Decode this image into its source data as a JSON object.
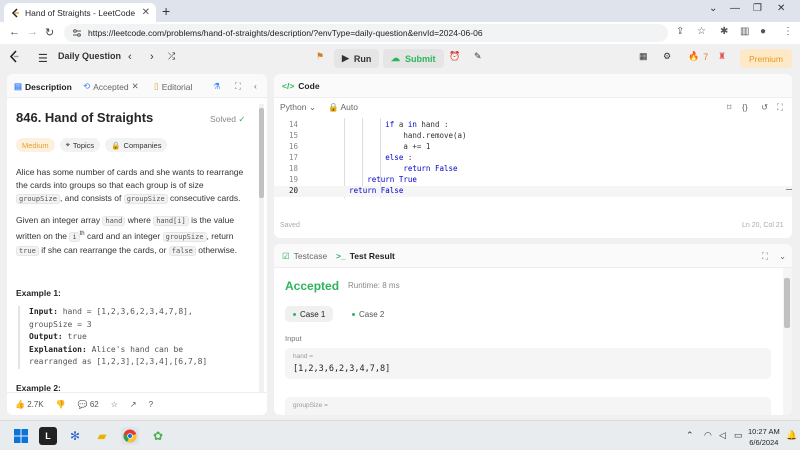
{
  "browser": {
    "tab_title": "Hand of Straights - LeetCode",
    "url": "https://leetcode.com/problems/hand-of-straights/description/?envType=daily-question&envId=2024-06-06"
  },
  "nav": {
    "daily_label": "Daily Question",
    "run_label": "Run",
    "submit_label": "Submit",
    "streak_count": "7",
    "premium_label": "Premium"
  },
  "left": {
    "tabs": {
      "description": "Description",
      "accepted": "Accepted",
      "editorial": "Editorial"
    },
    "problem_title": "846. Hand of Straights",
    "solved_label": "Solved",
    "tags": {
      "difficulty": "Medium",
      "topics": "Topics",
      "companies": "Companies"
    },
    "para1": {
      "t1": "Alice has some number of cards and she wants to rearrange the cards into groups so that each group is of size ",
      "c1": "groupSize",
      "t2": ", and consists of ",
      "c2": "groupSize",
      "t3": " consecutive cards."
    },
    "para2": {
      "t1": "Given an integer array ",
      "c1": "hand",
      "t2": " where ",
      "c2": "hand[i]",
      "t3": " is the value written on the ",
      "c3": "i",
      "sup": "th",
      "t4": " card and an integer ",
      "c4": "groupSize",
      "t5": ", return ",
      "c5": "true",
      "t6": " if she can rearrange the cards, or ",
      "c6": "false",
      "t7": " otherwise."
    },
    "example1": {
      "heading": "Example 1:",
      "input_label": "Input:",
      "input_value": " hand = [1,2,3,6,2,3,4,7,8],",
      "input_value2": "groupSize = 3",
      "output_label": "Output:",
      "output_value": " true",
      "explanation_label": "Explanation:",
      "explanation_value": " Alice's hand can be",
      "explanation_value2": "rearranged as [1,2,3],[2,3,4],[6,7,8]"
    },
    "example2_heading": "Example 2:",
    "footer": {
      "likes": "2.7K",
      "comments": "62"
    }
  },
  "code": {
    "header": "Code",
    "language": "Python",
    "auto_label": "Auto",
    "lines": [
      {
        "num": "14",
        "indent": "                  ",
        "kw1": "if",
        "mid": " a ",
        "kw2": "in",
        "rest": " hand :"
      },
      {
        "num": "15",
        "indent": "                      ",
        "kw1": "",
        "mid": "hand.remove(a)",
        "kw2": "",
        "rest": ""
      },
      {
        "num": "16",
        "indent": "                      ",
        "kw1": "",
        "mid": "a += 1",
        "kw2": "",
        "rest": ""
      },
      {
        "num": "17",
        "indent": "                  ",
        "kw1": "else",
        "mid": " :",
        "kw2": "",
        "rest": ""
      },
      {
        "num": "18",
        "indent": "                      ",
        "kw1": "return",
        "mid": " ",
        "kw2": "False",
        "rest": ""
      },
      {
        "num": "19",
        "indent": "              ",
        "kw1": "return",
        "mid": " ",
        "kw2": "True",
        "rest": ""
      },
      {
        "num": "20",
        "indent": "          ",
        "kw1": "return",
        "mid": " ",
        "kw2": "False",
        "rest": ""
      }
    ],
    "saved_label": "Saved",
    "cursor_pos": "Ln 20, Col 21"
  },
  "test": {
    "testcase_tab": "Testcase",
    "result_tab": "Test Result",
    "status": "Accepted",
    "runtime": "Runtime: 8 ms",
    "case1": "Case 1",
    "case2": "Case 2",
    "input_label": "Input",
    "hand_name": "hand =",
    "hand_value": "[1,2,3,6,2,3,4,7,8]",
    "group_name": "groupSize ="
  },
  "taskbar": {
    "time": "10:27 AM",
    "date": "6/6/2024"
  },
  "colors": {
    "accent_green": "#2db55d",
    "medium_orange": "#e3a030",
    "premium": "#e39b17"
  }
}
